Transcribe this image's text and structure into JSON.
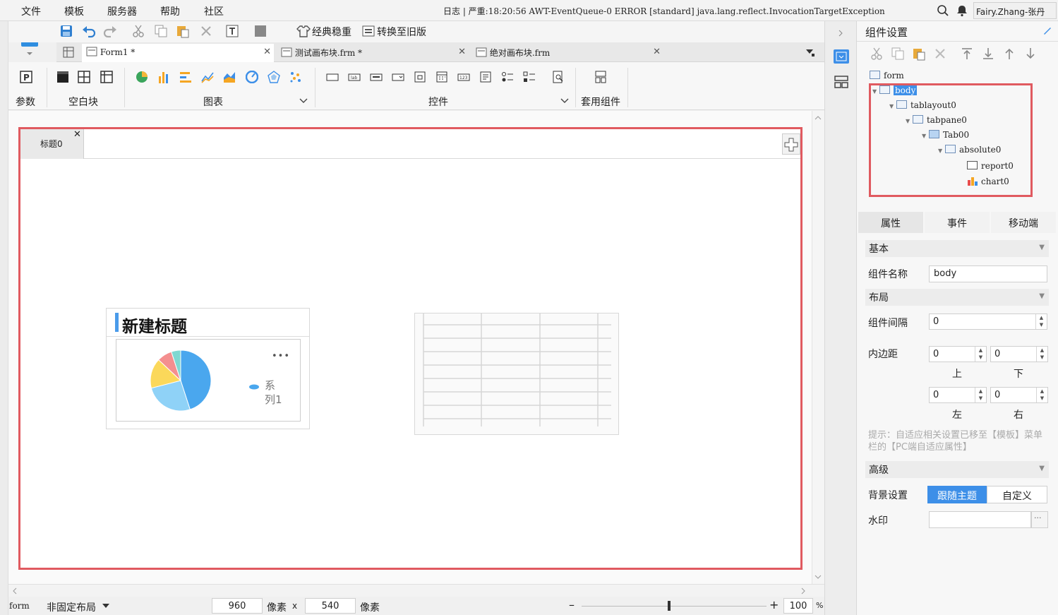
{
  "menubar": {
    "items": [
      "文件",
      "模板",
      "服务器",
      "帮助",
      "社区"
    ],
    "log": "日志 | 严重:18:20:56 AWT-EventQueue-0 ERROR [standard] java.lang.reflect.InvocationTargetException",
    "user": "Fairy.Zhang-张丹"
  },
  "toolbar": {
    "classic": "经典稳重",
    "convert": "转换至旧版"
  },
  "doc_tabs": [
    {
      "label": "Form1 *"
    },
    {
      "label": "测试画布块.frm *"
    },
    {
      "label": "绝对画布块.frm"
    }
  ],
  "ribbon": {
    "params_label": "参数",
    "blank_label": "空白块",
    "charts_label": "图表",
    "controls_label": "控件",
    "apply_label": "套用组件"
  },
  "canvas": {
    "tab_title": "标题0",
    "chart_widget": {
      "title": "新建标题",
      "more": "•••",
      "legend": "系列1"
    }
  },
  "chart_data": {
    "type": "pie",
    "title": "新建标题",
    "series": [
      {
        "name": "系列1",
        "values": [
          45,
          26,
          16,
          8,
          5
        ]
      }
    ],
    "colors": [
      "#4aa7ee",
      "#8fd2f7",
      "#fbd85a",
      "#f48f8f",
      "#7fd8d1"
    ],
    "legend_position": "right"
  },
  "status": {
    "component": "form",
    "layout": "非固定布局",
    "width": "960",
    "width_unit": "像素",
    "times": "x",
    "height": "540",
    "height_unit": "像素",
    "zoom": "100",
    "zoom_unit": "%"
  },
  "panel": {
    "title": "组件设置",
    "tree": [
      {
        "label": "form"
      },
      {
        "label": "body"
      },
      {
        "label": "tablayout0"
      },
      {
        "label": "tabpane0"
      },
      {
        "label": "Tab00"
      },
      {
        "label": "absolute0"
      },
      {
        "label": "report0"
      },
      {
        "label": "chart0"
      }
    ],
    "tabs": [
      "属性",
      "事件",
      "移动端"
    ],
    "basic": "基本",
    "name_label": "组件名称",
    "name_value": "body",
    "layout": "布局",
    "gap_label": "组件间隔",
    "gap_value": "0",
    "padding_label": "内边距",
    "pad_top": "0",
    "pad_bottom": "0",
    "pad_left": "0",
    "pad_right": "0",
    "top": "上",
    "bottom": "下",
    "left": "左",
    "right": "右",
    "hint": "提示：自适应相关设置已移至【模板】菜单栏的【PC端自适应属性】",
    "advanced": "高级",
    "bg_label": "背景设置",
    "bg_follow": "跟随主题",
    "bg_custom": "自定义",
    "watermark_label": "水印",
    "watermark_btn": "···"
  },
  "colors": {
    "highlight": "#e05a60",
    "accent": "#4a9bea",
    "selected": "#3d8fe8"
  }
}
